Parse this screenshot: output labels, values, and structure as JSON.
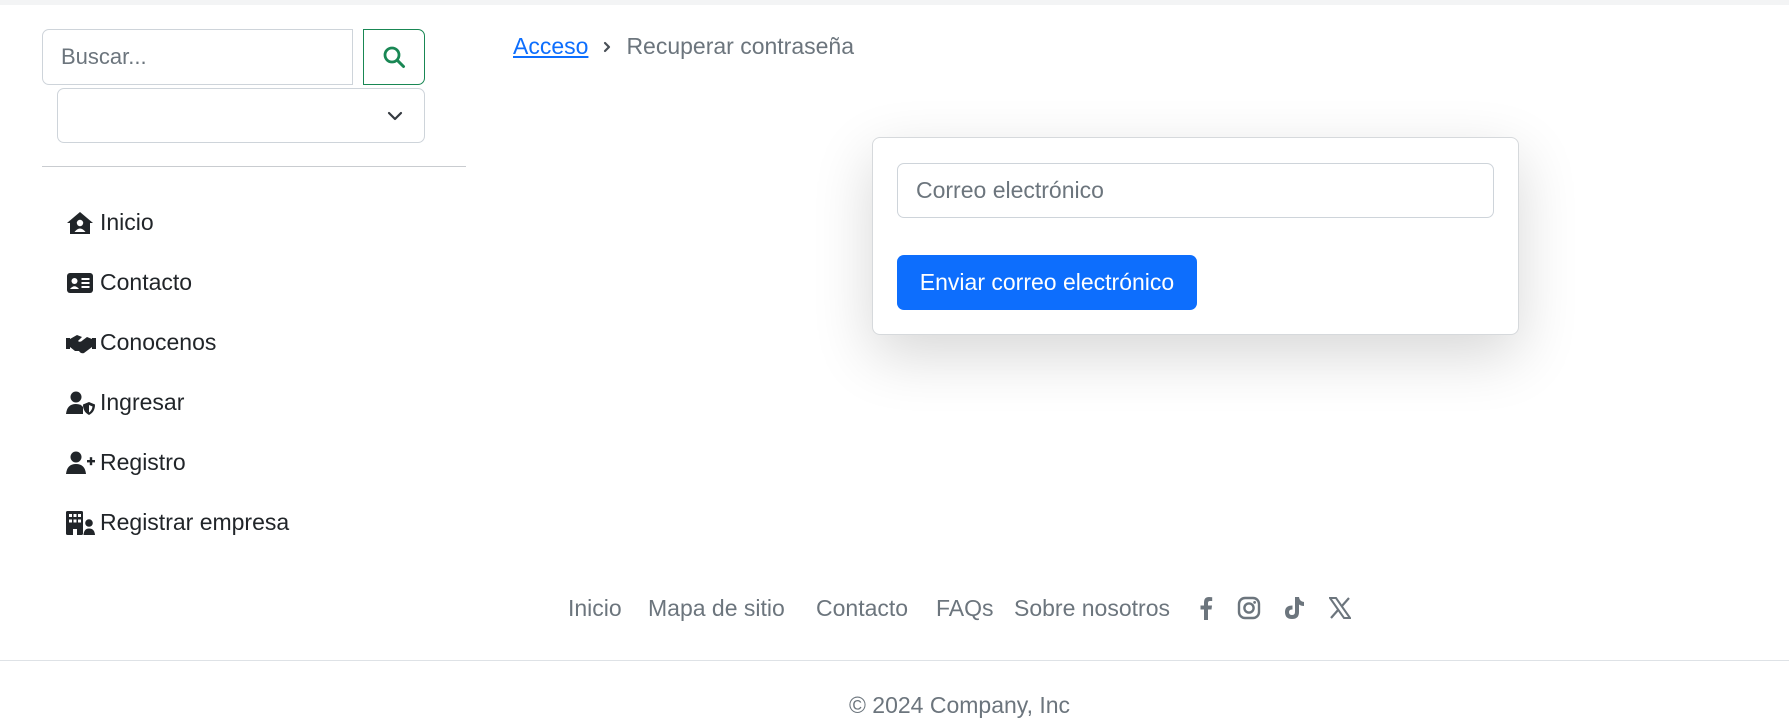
{
  "search": {
    "placeholder": "Buscar...",
    "button_icon": "search-icon"
  },
  "select": {
    "value": ""
  },
  "sidebar": {
    "items": [
      {
        "label": "Inicio",
        "icon": "house-user-icon"
      },
      {
        "label": "Contacto",
        "icon": "address-card-icon"
      },
      {
        "label": "Conocenos",
        "icon": "handshake-icon"
      },
      {
        "label": "Ingresar",
        "icon": "user-shield-icon"
      },
      {
        "label": "Registro",
        "icon": "user-plus-icon"
      },
      {
        "label": "Registrar empresa",
        "icon": "building-user-icon"
      }
    ]
  },
  "breadcrumb": {
    "link": "Acceso",
    "current": "Recuperar contraseña"
  },
  "form": {
    "email_placeholder": "Correo electrónico",
    "submit_label": "Enviar correo electrónico"
  },
  "footer": {
    "links": [
      "Inicio",
      "Mapa de sitio",
      "Contacto",
      "FAQs",
      "Sobre nosotros"
    ],
    "social": [
      "facebook-icon",
      "instagram-icon",
      "tiktok-icon",
      "x-icon"
    ],
    "copyright": "© 2024 Company, Inc"
  },
  "colors": {
    "primary": "#0d6efd",
    "success": "#198754",
    "muted": "#6c757d",
    "text": "#212529"
  }
}
